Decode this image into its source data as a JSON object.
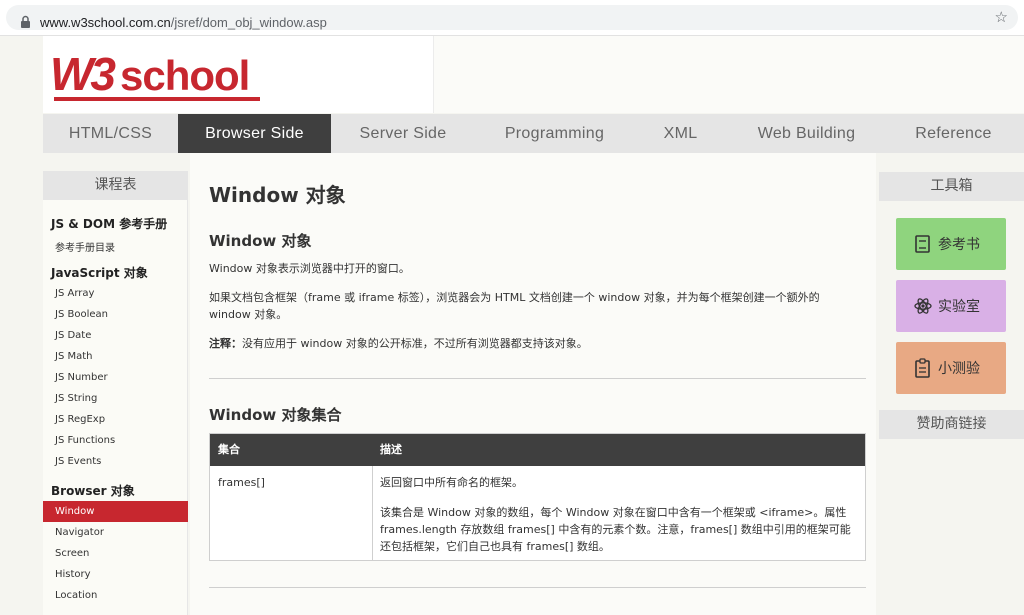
{
  "browser": {
    "url_host": "www.w3school.com.cn",
    "url_path": "/jsref/dom_obj_window.asp"
  },
  "logo": {
    "text": "W3school"
  },
  "nav": {
    "items": [
      "HTML/CSS",
      "Browser Side",
      "Server Side",
      "Programming",
      "XML",
      "Web Building",
      "Reference"
    ],
    "active": "Browser Side"
  },
  "sidebar": {
    "title": "课程表",
    "sections": [
      {
        "title": "JS & DOM 参考手册",
        "links": [
          "参考手册目录"
        ]
      },
      {
        "title": "JavaScript 对象",
        "links": [
          "JS Array",
          "JS Boolean",
          "JS Date",
          "JS Math",
          "JS Number",
          "JS String",
          "JS RegExp",
          "JS Functions",
          "JS Events"
        ]
      },
      {
        "title": "Browser 对象",
        "links": [
          "Window",
          "Navigator",
          "Screen",
          "History",
          "Location"
        ]
      }
    ],
    "active_link": "Window"
  },
  "main": {
    "page_title": "Window 对象",
    "section1": {
      "title": "Window 对象",
      "p1": "Window 对象表示浏览器中打开的窗口。",
      "p2": "如果文档包含框架（frame 或 iframe 标签），浏览器会为 HTML 文档创建一个 window 对象，并为每个框架创建一个额外的 window 对象。",
      "note_label": "注释：",
      "note_text": "没有应用于 window 对象的公开标准，不过所有浏览器都支持该对象。"
    },
    "section2": {
      "title": "Window 对象集合",
      "table": {
        "headers": [
          "集合",
          "描述"
        ],
        "rows": [
          {
            "name": "frames[]",
            "desc1": "返回窗口中所有命名的框架。",
            "desc2": "该集合是 Window 对象的数组，每个 Window 对象在窗口中含有一个框架或 <iframe>。属性 frames.length 存放数组 frames[] 中含有的元素个数。注意，frames[] 数组中引用的框架可能还包括框架，它们自己也具有 frames[] 数组。"
          }
        ]
      }
    }
  },
  "right_sidebar": {
    "title": "工具箱",
    "tools": [
      {
        "label": "参考书",
        "icon": "book-icon",
        "color": "#8fd47e"
      },
      {
        "label": "实验室",
        "icon": "atom-icon",
        "color": "#d9b0e6"
      },
      {
        "label": "小测验",
        "icon": "clipboard-icon",
        "color": "#e8a984"
      }
    ],
    "sponsor_title": "赞助商链接"
  },
  "colors": {
    "nav_active": "#3f3f3f",
    "sidebar_active": "#c7272f",
    "logo_red": "#c7272f"
  }
}
